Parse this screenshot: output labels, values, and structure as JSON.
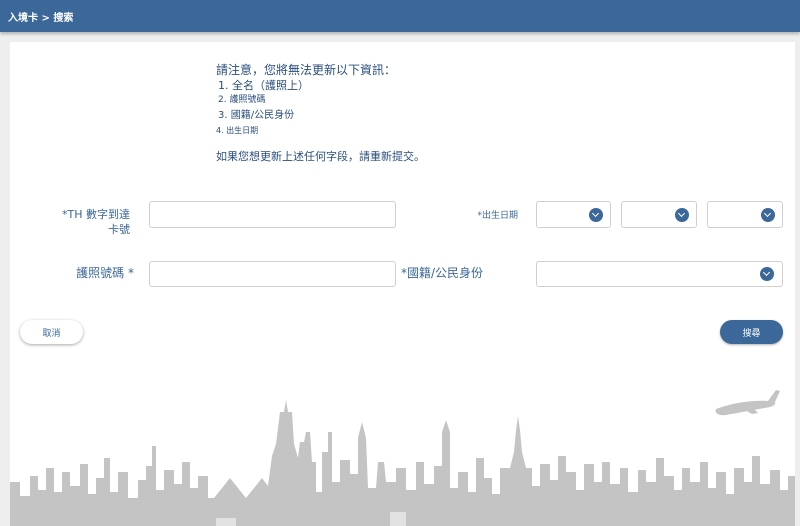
{
  "header": {
    "breadcrumb": "入境卡 > 搜索"
  },
  "notice": {
    "title": "請注意，您將無法更新以下資訊：",
    "items": [
      "1. 全名（護照上）",
      "2. 護照號碼",
      "3. 國籍/公民身份",
      "4. 出生日期"
    ],
    "resubmit": "如果您想更新上述任何字段，請重新提交。"
  },
  "form": {
    "th_card_label_line1": "*TH 數字到達",
    "th_card_label_line2": "卡號",
    "th_card_value": "",
    "dob_label": "*出生日期",
    "dob_day_value": "",
    "dob_month_value": "",
    "dob_year_value": "",
    "passport_label": "護照號碼 *",
    "passport_value": "",
    "nationality_label": "*國籍/公民身份",
    "nationality_value": ""
  },
  "buttons": {
    "cancel": "取消",
    "search": "搜尋"
  },
  "colors": {
    "brand": "#3b6799",
    "text": "#2b4f7d",
    "skyline": "#c4c4c4"
  },
  "icons": {
    "select_arrow": "chevron-down-icon"
  }
}
